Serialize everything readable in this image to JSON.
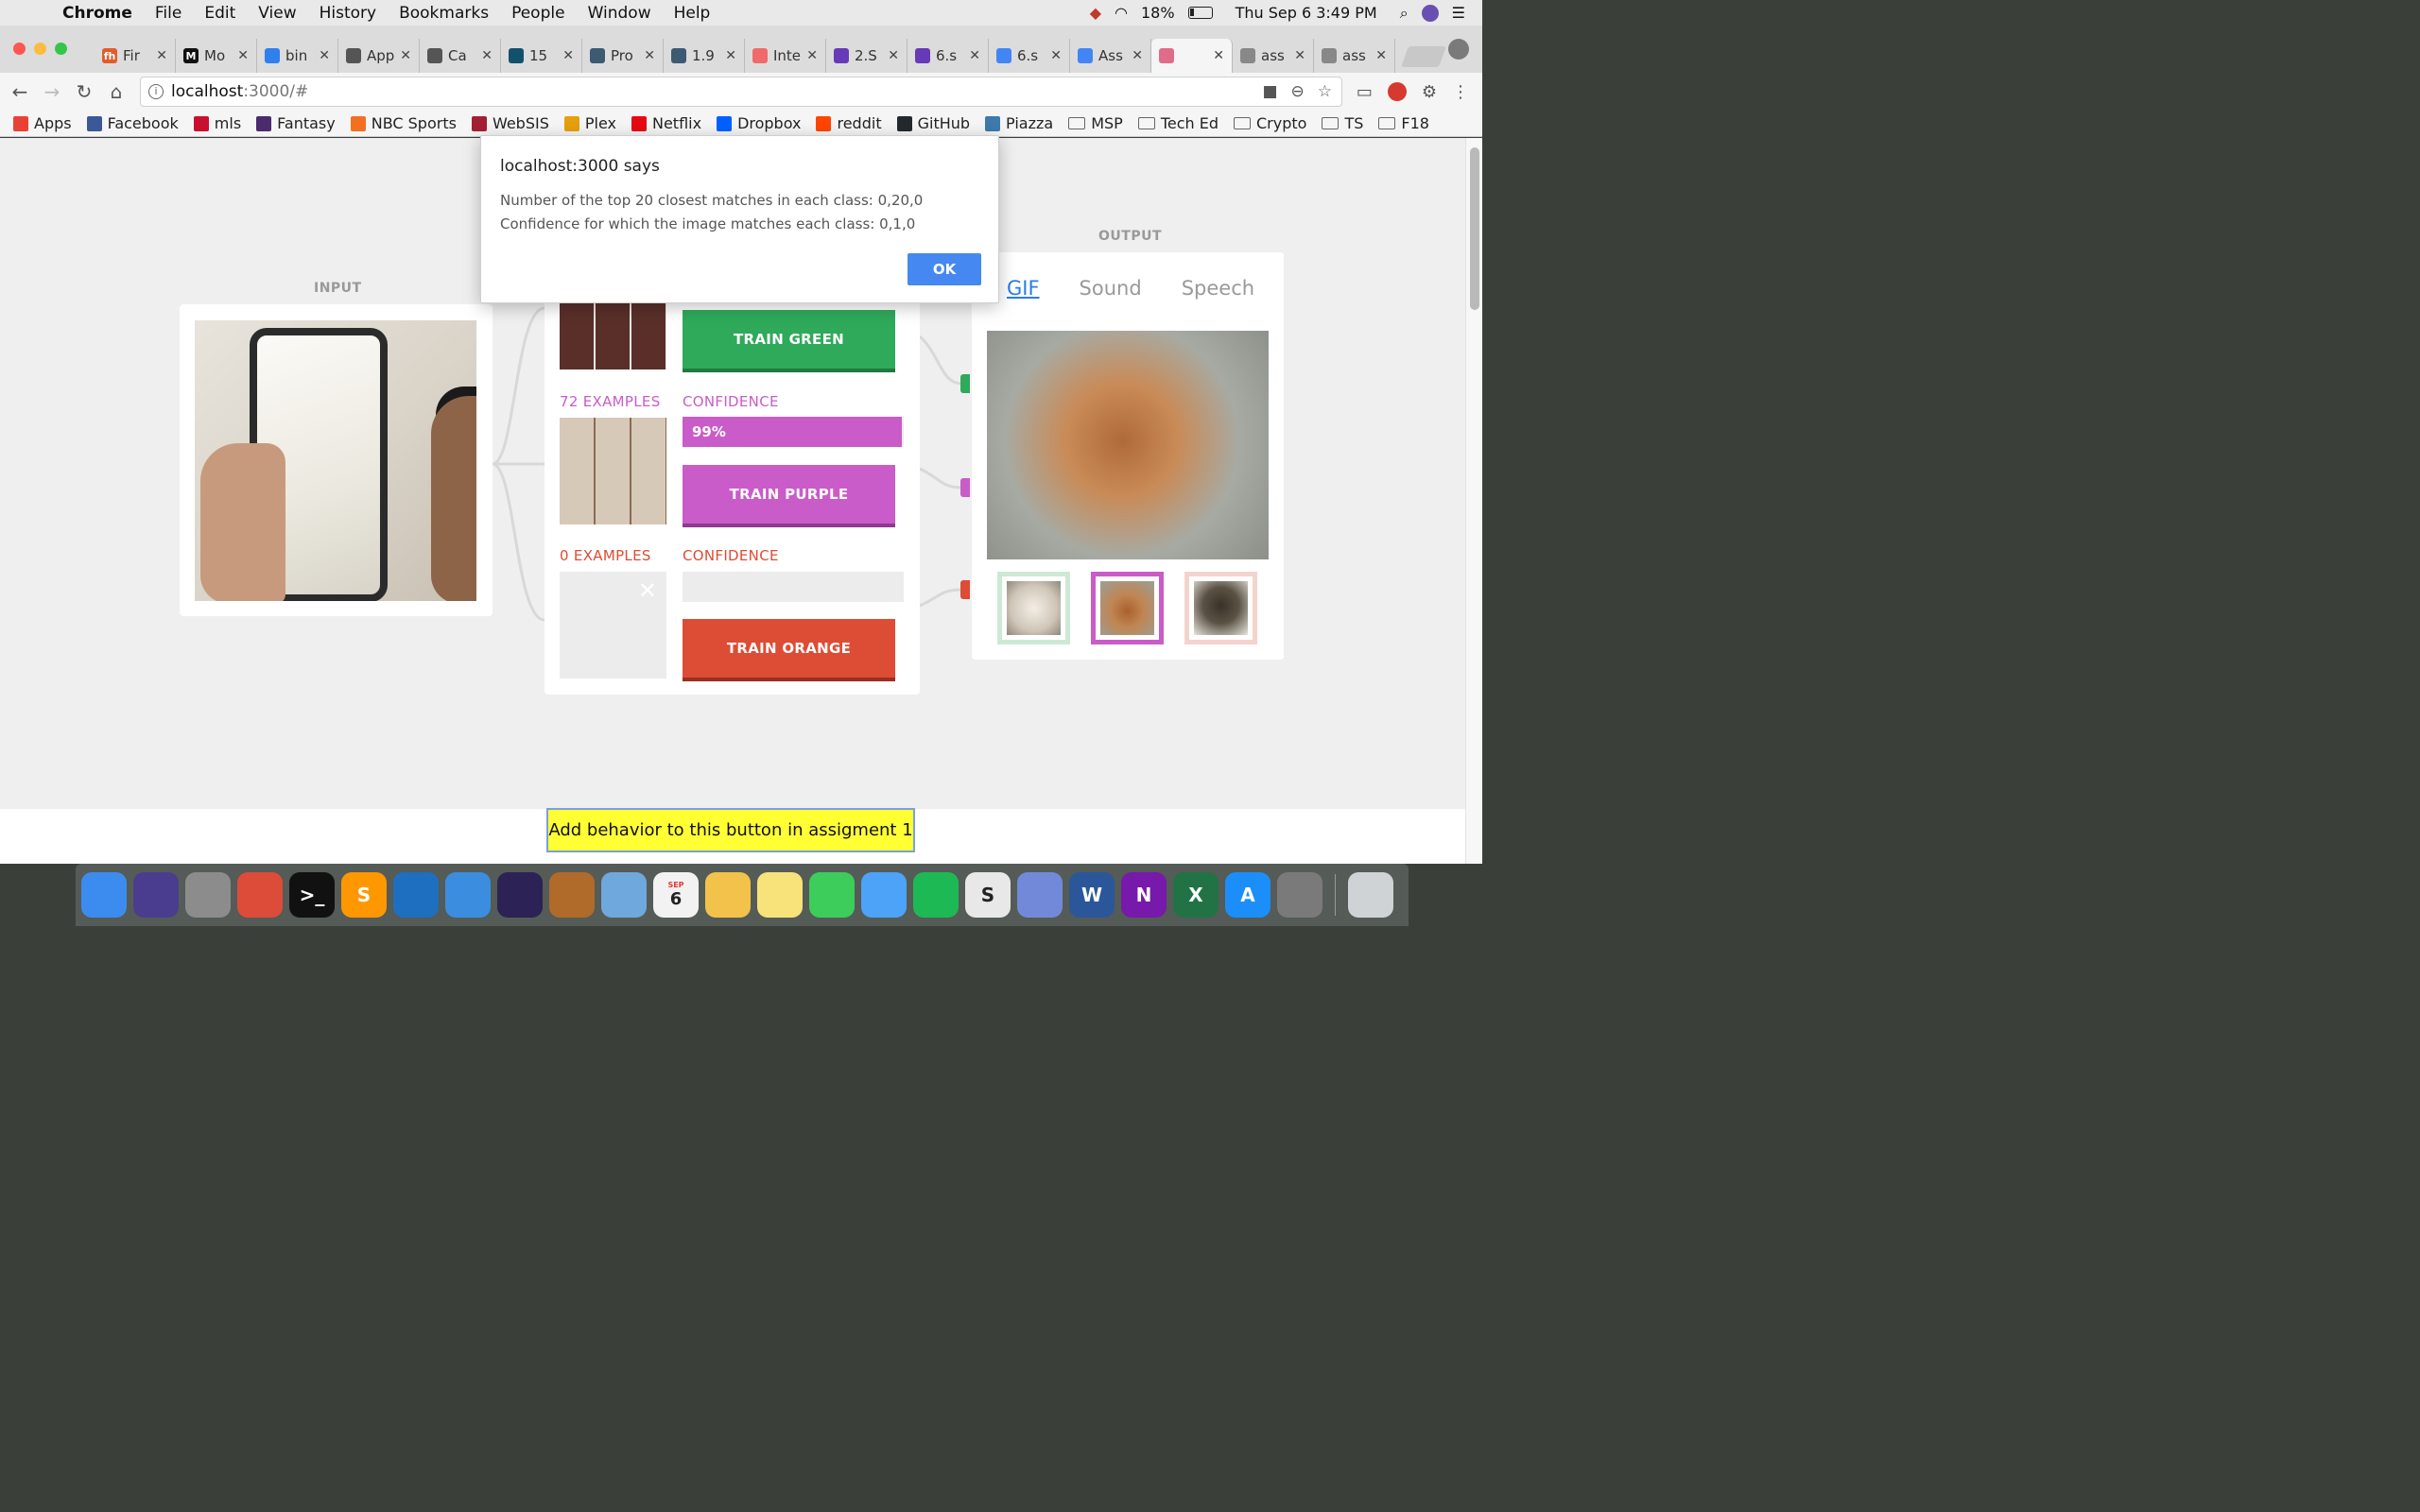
{
  "menubar": {
    "app": "Chrome",
    "items": [
      "File",
      "Edit",
      "View",
      "History",
      "Bookmarks",
      "People",
      "Window",
      "Help"
    ],
    "battery": "18%",
    "datetime": "Thu Sep 6  3:49 PM"
  },
  "tabs": [
    {
      "label": "Fir",
      "icon_color": "#e35b2b",
      "icon_text": "fh"
    },
    {
      "label": "Mo",
      "icon_color": "#111111",
      "icon_text": "M"
    },
    {
      "label": "bin",
      "icon_color": "#2f80ed",
      "icon_text": ""
    },
    {
      "label": "App",
      "icon_color": "#555555",
      "icon_text": ""
    },
    {
      "label": "Ca",
      "icon_color": "#555555",
      "icon_text": ""
    },
    {
      "label": "15",
      "icon_color": "#12516b",
      "icon_text": ""
    },
    {
      "label": "Pro",
      "icon_color": "#3d5a73",
      "icon_text": ""
    },
    {
      "label": "1.9",
      "icon_color": "#3d5a73",
      "icon_text": ""
    },
    {
      "label": "Inte",
      "icon_color": "#f06a6a",
      "icon_text": ""
    },
    {
      "label": "2.S",
      "icon_color": "#673ab7",
      "icon_text": ""
    },
    {
      "label": "6.s",
      "icon_color": "#673ab7",
      "icon_text": ""
    },
    {
      "label": "6.s",
      "icon_color": "#4285f4",
      "icon_text": ""
    },
    {
      "label": "Ass",
      "icon_color": "#4285f4",
      "icon_text": ""
    },
    {
      "label": "",
      "icon_color": "#e06c8a",
      "icon_text": ""
    },
    {
      "label": "ass",
      "icon_color": "#888888",
      "icon_text": ""
    },
    {
      "label": "ass",
      "icon_color": "#888888",
      "icon_text": ""
    }
  ],
  "address": {
    "host": "localhost",
    "path": ":3000/#"
  },
  "bookmarks": [
    {
      "label": "Apps",
      "icon_color": "#e94235",
      "folder": false
    },
    {
      "label": "Facebook",
      "icon_color": "#3b5998",
      "folder": false
    },
    {
      "label": "mls",
      "icon_color": "#c8102e",
      "folder": false
    },
    {
      "label": "Fantasy",
      "icon_color": "#4b2a6e",
      "folder": false
    },
    {
      "label": "NBC Sports",
      "icon_color": "#f37021",
      "folder": false
    },
    {
      "label": "WebSIS",
      "icon_color": "#a31f34",
      "folder": false
    },
    {
      "label": "Plex",
      "icon_color": "#e5a00d",
      "folder": false
    },
    {
      "label": "Netflix",
      "icon_color": "#e50914",
      "folder": false
    },
    {
      "label": "Dropbox",
      "icon_color": "#0061ff",
      "folder": false
    },
    {
      "label": "reddit",
      "icon_color": "#ff4500",
      "folder": false
    },
    {
      "label": "GitHub",
      "icon_color": "#24292e",
      "folder": false
    },
    {
      "label": "Piazza",
      "icon_color": "#3e7aab",
      "folder": false
    },
    {
      "label": "MSP",
      "icon_color": "",
      "folder": true
    },
    {
      "label": "Tech Ed",
      "icon_color": "",
      "folder": true
    },
    {
      "label": "Crypto",
      "icon_color": "",
      "folder": true
    },
    {
      "label": "TS",
      "icon_color": "",
      "folder": true
    },
    {
      "label": "F18",
      "icon_color": "",
      "folder": true
    }
  ],
  "input": {
    "label": "INPUT"
  },
  "training": {
    "green": {
      "button": "TRAIN GREEN",
      "color": "#2fa95a"
    },
    "purple": {
      "examples": "72 EXAMPLES",
      "confidence_label": "CONFIDENCE",
      "confidence_value": "99%",
      "confidence_fraction": 0.99,
      "button": "TRAIN PURPLE",
      "color": "#c95cc9"
    },
    "orange": {
      "examples": "0 EXAMPLES",
      "confidence_label": "CONFIDENCE",
      "button": "TRAIN ORANGE",
      "color": "#dd4c34"
    }
  },
  "output": {
    "label": "OUTPUT",
    "tabs": [
      "GIF",
      "Sound",
      "Speech"
    ],
    "active_tab": "GIF"
  },
  "dialog": {
    "title": "localhost:3000 says",
    "line1": "Number of the top 20 closest matches in each class: 0,20,0",
    "line2": "Confidence for which the image matches each class: 0,1,0",
    "ok": "OK"
  },
  "bottom_button": "Add behavior to this button in assigment 1",
  "dock": [
    {
      "name": "finder-icon",
      "color": "#3c8cf0",
      "text": ""
    },
    {
      "name": "siri-icon",
      "color": "#4a3d8f",
      "text": ""
    },
    {
      "name": "launchpad-icon",
      "color": "#8c8c8c",
      "text": ""
    },
    {
      "name": "chrome-icon",
      "color": "#dd4b39",
      "text": ""
    },
    {
      "name": "terminal-icon",
      "color": "#111111",
      "text": ">_"
    },
    {
      "name": "sublime-icon",
      "color": "#ff9800",
      "text": "S"
    },
    {
      "name": "vscode-icon",
      "color": "#1e6fbf",
      "text": ""
    },
    {
      "name": "xcode-icon",
      "color": "#3b8de0",
      "text": ""
    },
    {
      "name": "eclipse-icon",
      "color": "#2c2255",
      "text": ""
    },
    {
      "name": "animal-app-icon",
      "color": "#b06a2a",
      "text": ""
    },
    {
      "name": "mail-icon",
      "color": "#6fa8dc",
      "text": ""
    },
    {
      "name": "calendar-icon",
      "color": "#f2f2f2",
      "text": "6"
    },
    {
      "name": "photos-icon",
      "color": "#f3c24b",
      "text": ""
    },
    {
      "name": "notes-icon",
      "color": "#f7e37a",
      "text": ""
    },
    {
      "name": "facetime-icon",
      "color": "#3ccd5b",
      "text": ""
    },
    {
      "name": "messages-icon",
      "color": "#4da3f7",
      "text": ""
    },
    {
      "name": "spotify-icon",
      "color": "#1db954",
      "text": ""
    },
    {
      "name": "slack-icon",
      "color": "#e8e8e8",
      "text": "S"
    },
    {
      "name": "discord-icon",
      "color": "#7289da",
      "text": ""
    },
    {
      "name": "word-icon",
      "color": "#2b579a",
      "text": "W"
    },
    {
      "name": "onenote-icon",
      "color": "#7719aa",
      "text": "N"
    },
    {
      "name": "excel-icon",
      "color": "#217346",
      "text": "X"
    },
    {
      "name": "appstore-icon",
      "color": "#1c8ef9",
      "text": "A"
    },
    {
      "name": "system-prefs-icon",
      "color": "#7a7a7a",
      "text": ""
    },
    {
      "name": "trash-icon",
      "color": "#cfd3d6",
      "text": ""
    }
  ],
  "dock_calendar_month": "SEP"
}
